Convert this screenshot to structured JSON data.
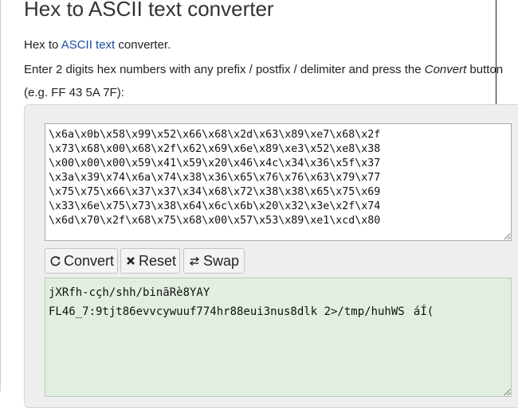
{
  "page": {
    "title": "Hex to ASCII text converter",
    "intro_prefix": "Hex to ",
    "intro_link": "ASCII text",
    "intro_suffix": " converter.",
    "instruction_prefix": "Enter 2 digits hex numbers with any prefix / postfix / delimiter and press the ",
    "instruction_emphasis": "Convert",
    "instruction_suffix": " button",
    "example": "(e.g. FF 43 5A 7F):"
  },
  "hex_input": {
    "value": "\\x6a\\x0b\\x58\\x99\\x52\\x66\\x68\\x2d\\x63\\x89\\xe7\\x68\\x2f\n\\x73\\x68\\x00\\x68\\x2f\\x62\\x69\\x6e\\x89\\xe3\\x52\\xe8\\x38\n\\x00\\x00\\x00\\x59\\x41\\x59\\x20\\x46\\x4c\\x34\\x36\\x5f\\x37\n\\x3a\\x39\\x74\\x6a\\x74\\x38\\x36\\x65\\x76\\x76\\x63\\x79\\x77\n\\x75\\x75\\x66\\x37\\x37\\x34\\x68\\x72\\x38\\x38\\x65\\x75\\x69\n\\x33\\x6e\\x75\\x73\\x38\\x64\\x6c\\x6b\\x20\\x32\\x3e\\x2f\\x74\n\\x6d\\x70\\x2f\\x68\\x75\\x68\\x00\\x57\\x53\\x89\\xe1\\xcd\\x80"
  },
  "buttons": {
    "convert": {
      "label": "Convert",
      "icon": "refresh-icon"
    },
    "reset": {
      "label": "Reset",
      "icon": "x-icon"
    },
    "swap": {
      "label": "Swap",
      "icon": "swap-icon"
    }
  },
  "ascii_output": {
    "value": "j\u000bXRfh-cçh/shh/binãRè8YAY\nFL46_7:9tjt86evvcywuuf774hr88eui3nus8dlk 2>/tmp/huhWSáÍ("
  },
  "colors": {
    "link": "#1a4ca1",
    "panel_bg": "#eeeeee",
    "output_bg": "#e2efe0"
  }
}
